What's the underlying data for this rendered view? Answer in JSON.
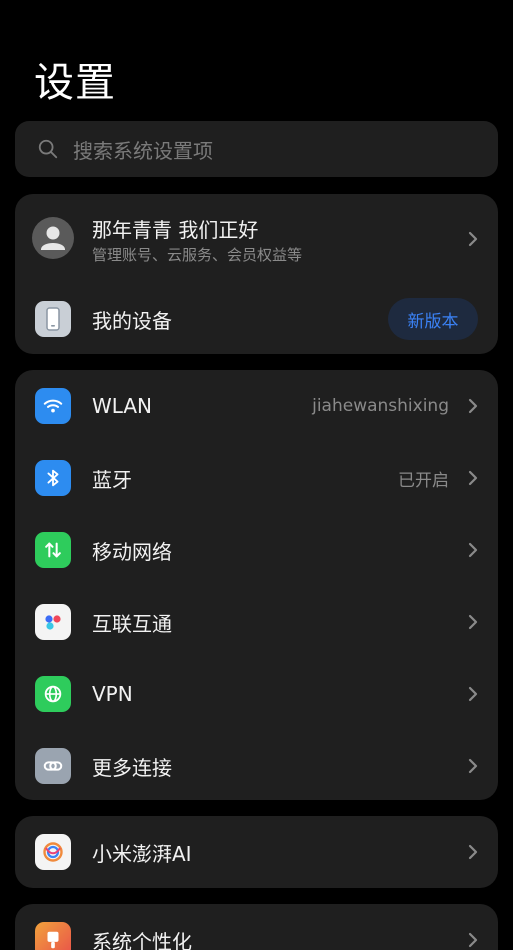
{
  "header": {
    "title": "设置"
  },
  "search": {
    "placeholder": "搜索系统设置项"
  },
  "account": {
    "name": "那年青青  我们正好",
    "subtitle": "管理账号、云服务、会员权益等"
  },
  "device": {
    "label": "我的设备",
    "badge": "新版本"
  },
  "connectivity": {
    "items": [
      {
        "label": "WLAN",
        "value": "jiahewanshixing",
        "icon": "wifi-icon",
        "color": "#2d8cf0"
      },
      {
        "label": "蓝牙",
        "value": "已开启",
        "icon": "bluetooth-icon",
        "color": "#2d8cf0"
      },
      {
        "label": "移动网络",
        "value": "",
        "icon": "mobile-data-icon",
        "color": "#2ecc5c"
      },
      {
        "label": "互联互通",
        "value": "",
        "icon": "interconnect-icon",
        "color": "#f4f4f4"
      },
      {
        "label": "VPN",
        "value": "",
        "icon": "vpn-globe-icon",
        "color": "#2ecc5c"
      },
      {
        "label": "更多连接",
        "value": "",
        "icon": "link-icon",
        "color": "#9aa4b0"
      }
    ]
  },
  "ai": {
    "label": "小米澎湃AI",
    "icon": "xiaomi-ai-icon"
  },
  "personalization": {
    "label": "系统个性化",
    "icon": "personalization-icon"
  },
  "colors": {
    "background": "#000000",
    "card": "#1f1f1f",
    "accent_blue": "#3b82f6"
  }
}
